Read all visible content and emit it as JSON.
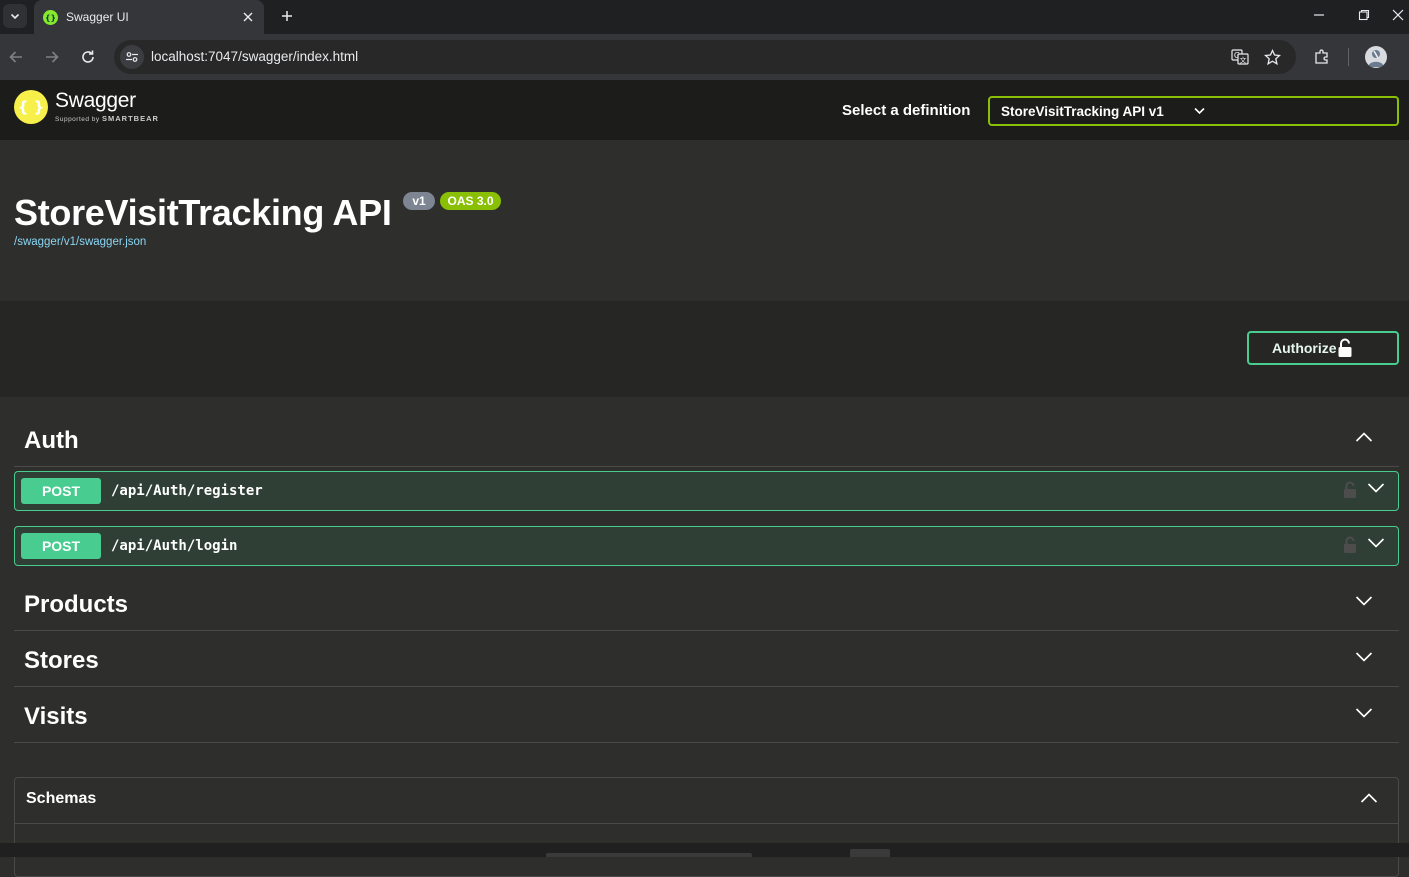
{
  "browser": {
    "tab_title": "Swagger UI",
    "url": "localhost:7047/swagger/index.html"
  },
  "topbar": {
    "logo_word": "Swagger",
    "logo_sub_prefix": "Supported by",
    "logo_sub_brand": "SMARTBEAR",
    "definition_label": "Select a definition",
    "definition_selected": "StoreVisitTracking API v1"
  },
  "info": {
    "title": "StoreVisitTracking API",
    "version_badge": "v1",
    "oas_badge": "OAS 3.0",
    "spec_link": "/swagger/v1/swagger.json"
  },
  "authorize_label": "Authorize",
  "tags": [
    {
      "name": "Auth",
      "expanded": true
    },
    {
      "name": "Products",
      "expanded": false
    },
    {
      "name": "Stores",
      "expanded": false
    },
    {
      "name": "Visits",
      "expanded": false
    }
  ],
  "operations": [
    {
      "method": "POST",
      "path": "/api/Auth/register"
    },
    {
      "method": "POST",
      "path": "/api/Auth/login"
    }
  ],
  "schemas_label": "Schemas",
  "colors": {
    "post": "#49cc90",
    "definition_border": "#89bf04",
    "version_badge": "#7d8492",
    "oas_badge": "#89bf04",
    "logo": "#f8f04a"
  }
}
